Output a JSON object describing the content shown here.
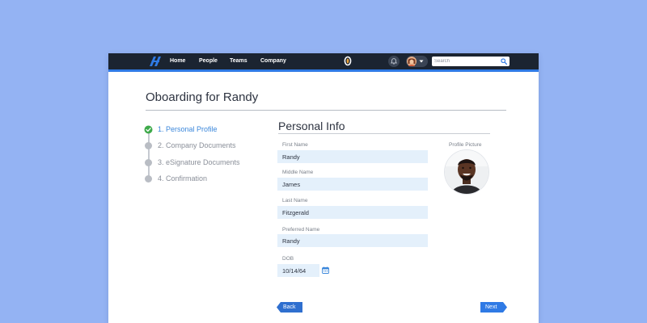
{
  "colors": {
    "background": "#94b3f3",
    "topbar": "#1b2431",
    "accent": "#2f7ae5",
    "input_bg": "#e4f0fb",
    "step_active": "#3b87db",
    "success": "#3faa4b"
  },
  "nav": {
    "logo_icon": "brand-logo-icon",
    "items": [
      {
        "label": "Home"
      },
      {
        "label": "People"
      },
      {
        "label": "Teams"
      },
      {
        "label": "Company"
      }
    ],
    "search": {
      "placeholder": "Search",
      "value": ""
    }
  },
  "page": {
    "title": "Oboarding for Randy"
  },
  "steps": [
    {
      "label": "1. Personal Profile",
      "status": "complete"
    },
    {
      "label": "2. Company Documents",
      "status": "pending"
    },
    {
      "label": "3. eSignature Documents",
      "status": "pending"
    },
    {
      "label": "4. Confirmation",
      "status": "pending"
    }
  ],
  "form": {
    "title": "Personal Info",
    "fields": [
      {
        "label": "First Name",
        "value": "Randy"
      },
      {
        "label": "Middle Name",
        "value": "James"
      },
      {
        "label": "Last Name",
        "value": "Fitzgerald"
      },
      {
        "label": "Preferred Name",
        "value": "Randy"
      },
      {
        "label": "DOB",
        "value": "10/14/64"
      }
    ],
    "profile_picture_label": "Profile Picture"
  },
  "buttons": {
    "back": "Back",
    "next": "Next"
  }
}
